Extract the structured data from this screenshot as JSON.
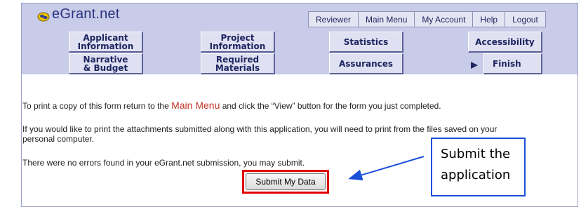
{
  "brand": {
    "name": "eGrant.net"
  },
  "top_nav": [
    {
      "label": "Reviewer"
    },
    {
      "label": "Main Menu"
    },
    {
      "label": "My Account"
    },
    {
      "label": "Help"
    },
    {
      "label": "Logout"
    }
  ],
  "section_nav": {
    "applicant_information": "Applicant\nInformation",
    "project_information": "Project\nInformation",
    "statistics": "Statistics",
    "accessibility": "Accessibility",
    "narrative_budget": "Narrative\n& Budget",
    "required_materials": "Required\nMaterials",
    "assurances": "Assurances",
    "finish": "Finish"
  },
  "content": {
    "print_form_before": "To print a copy of this form return to the ",
    "print_form_link": "Main Menu",
    "print_form_after": " and click the “View” button for the form you just completed.",
    "print_attachments": "If you would like to print the attachments submitted along with this application, you will need to print from the files saved on your personal computer.",
    "no_errors": "There were no errors found in your eGrant.net submission, you may submit.",
    "submit_button": "Submit My Data"
  },
  "annotation": {
    "line1": "Submit the",
    "line2": "application"
  },
  "colors": {
    "header_bg": "#c9cce8",
    "highlight_red": "#e00000",
    "callout_blue": "#1b4fd8",
    "link_red": "#c0392b"
  },
  "icons": {
    "logo": "egrant-logo-icon",
    "finish_marker": "play-arrow-icon"
  }
}
